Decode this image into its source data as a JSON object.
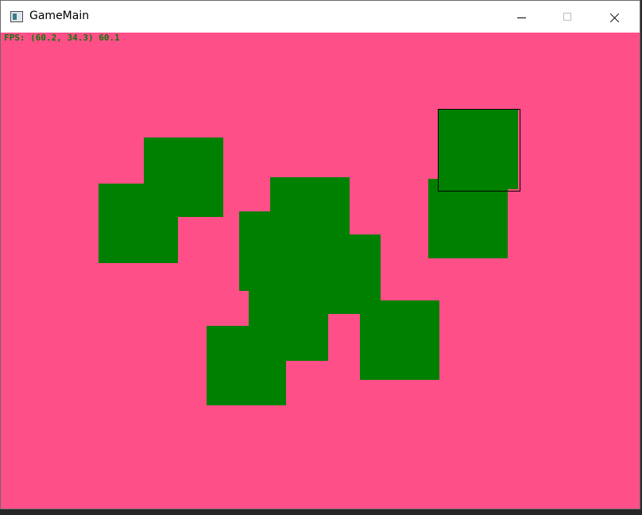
{
  "window": {
    "title": "GameMain",
    "app_icon": "window-app-icon"
  },
  "colors": {
    "background": "#ff4f88",
    "block": "#008000",
    "fps_text": "#0a7a0a"
  },
  "hud": {
    "fps_text": "FPS: (60.2, 34.3) 60.1"
  },
  "blocks": [
    {
      "id": "block-a"
    },
    {
      "id": "block-b"
    },
    {
      "id": "block-c"
    },
    {
      "id": "block-d"
    },
    {
      "id": "block-e"
    },
    {
      "id": "block-f"
    },
    {
      "id": "block-g"
    },
    {
      "id": "block-h"
    },
    {
      "id": "block-i"
    },
    {
      "id": "block-j"
    },
    {
      "id": "block-k"
    }
  ],
  "selected_block": "block-k"
}
